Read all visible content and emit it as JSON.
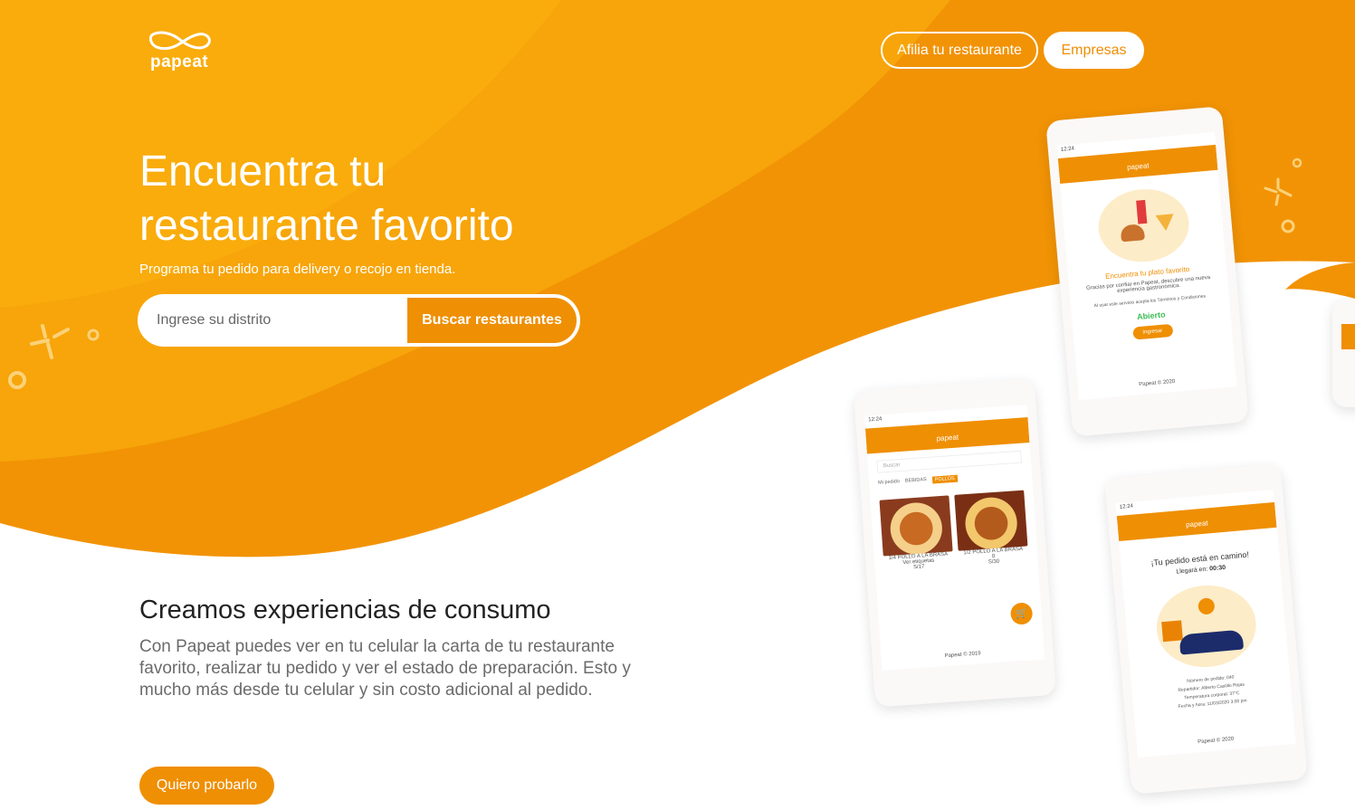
{
  "brand": {
    "name": "papeat",
    "accent": "#ef8f03",
    "accent_light": "#f9b00a"
  },
  "nav": {
    "affiliate_label": "Afilia tu restaurante",
    "business_label": "Empresas"
  },
  "hero": {
    "title_line1": "Encuentra tu",
    "title_line2": "restaurante favorito",
    "subtitle": "Programa tu pedido para delivery o recojo en tienda.",
    "search_placeholder": "Ingrese su distrito",
    "search_button": "Buscar restaurantes"
  },
  "section": {
    "title": "Creamos experiencias de consumo",
    "body": "Con Papeat puedes ver en tu celular la carta de tu restaurante favorito, realizar tu pedido y ver el estado de preparación. Esto y mucho más desde tu celular y sin costo adicional al pedido.",
    "cta_label": "Quiero probarlo"
  },
  "phones": {
    "menu": {
      "time": "12:24",
      "logo": "papeat",
      "search": "Buscar",
      "tabs": [
        "Mi pedido",
        "BEBIDAS",
        "POLLOS"
      ],
      "items": [
        {
          "name": "1/4 POLLO A LA BRASA",
          "tag": "Ver etiquetas",
          "price": "S/17"
        },
        {
          "name": "1/2 POLLO A LA BRASA",
          "qty": "0",
          "price": "S/30"
        }
      ],
      "footer": "Papeat © 2019"
    },
    "welcome": {
      "time": "12:24",
      "logo": "papeat",
      "heading": "Encuentra tu plato favorito",
      "text": "Gracias por confiar en Papeat, descubre una nueva experiencia gastronómica.",
      "terms": "Al usar este servicio acepta los Términos y Condiciones",
      "status": "Abierto",
      "button": "Ingresar",
      "footer": "Papeat © 2020"
    },
    "tracking": {
      "time": "12:24",
      "logo": "papeat",
      "heading": "¡Tu pedido está en camino!",
      "eta_label": "Llegará en:",
      "eta": "00:30",
      "details": [
        "Número de pedido: 040",
        "Repartidor: Alberto Castillo Rojas",
        "Temperatura corporal: 37°C",
        "Fecha y hora: 11/03/2020 3:00 pm"
      ],
      "footer": "Papeat © 2020"
    }
  }
}
